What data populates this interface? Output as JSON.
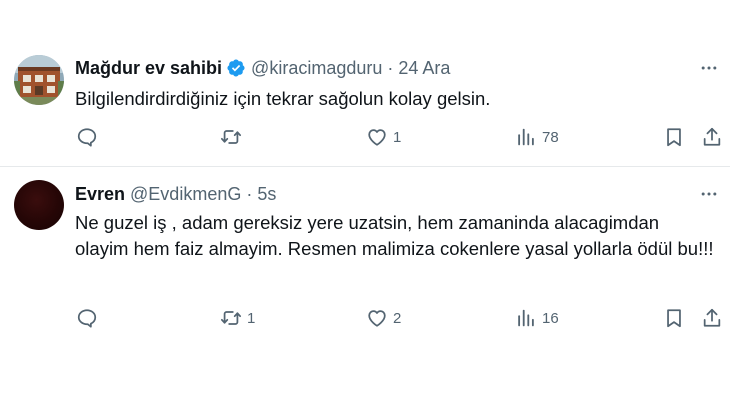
{
  "tweets": [
    {
      "display_name": "Mağdur ev sahibi",
      "verified": true,
      "handle": "@kiracimagduru",
      "separator": "·",
      "time": "24 Ara",
      "text": "Bilgilendirdirdiğiniz için tekrar sağolun kolay gelsin.",
      "retweets": "",
      "likes": "1",
      "views": "78"
    },
    {
      "display_name": "Evren",
      "verified": false,
      "handle": "@EvdikmenG",
      "separator": "·",
      "time": "5s",
      "text": "Ne guzel iş , adam gereksiz yere uzatsin, hem zamaninda alacagimdan olayim hem faiz almayim. Resmen malimiza cokenlere yasal yollarla ödül bu!!!",
      "retweets": "1",
      "likes": "2",
      "views": "16"
    }
  ],
  "colors": {
    "text_primary": "#0f1419",
    "text_secondary": "#536471",
    "verified_blue": "#1d9bf0",
    "divider": "#e6e9eb"
  },
  "icons": [
    "more-icon",
    "verified-badge-icon",
    "reply-icon",
    "retweet-icon",
    "like-icon",
    "views-icon",
    "bookmark-icon",
    "share-icon"
  ]
}
